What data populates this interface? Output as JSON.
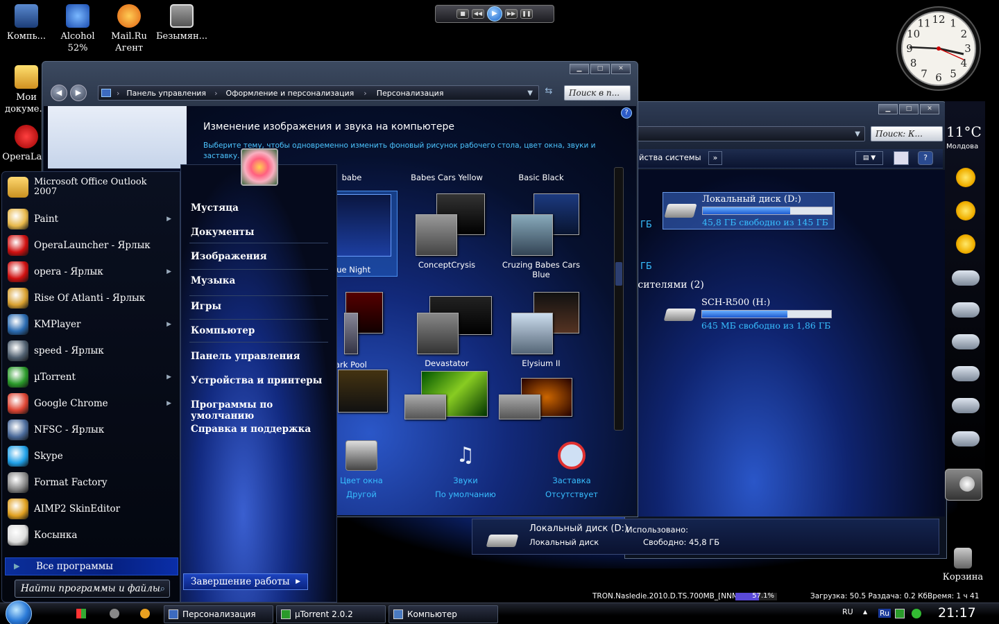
{
  "desktop": {
    "icons": [
      {
        "label": "Компь...",
        "icon": "computer-icon"
      },
      {
        "label": "Alcohol 52%",
        "icon": "alcohol-icon"
      },
      {
        "label": "Mail.Ru Агент",
        "icon": "mailru-agent-icon"
      },
      {
        "label": "Безымян...",
        "icon": "image-file-icon"
      },
      {
        "label": "Мои докуме...",
        "icon": "my-documents-icon"
      },
      {
        "label": "OperaLa...",
        "icon": "opera-icon"
      },
      {
        "label": "Корзина",
        "icon": "recycle-bin-icon"
      }
    ]
  },
  "clock_gadget": {
    "numerals": [
      "12",
      "1",
      "2",
      "3",
      "4",
      "5",
      "6",
      "7",
      "8",
      "9",
      "10",
      "11"
    ]
  },
  "weather_gadget": {
    "temperature": "11°C",
    "city": "Молдова"
  },
  "control_panel": {
    "breadcrumb": [
      "Панель управления",
      "Оформление и персонализация",
      "Персонализация"
    ],
    "search_placeholder": "Поиск в п...",
    "title": "Изменение изображения и звука на компьютере",
    "description": "Выберите тему, чтобы одновременно изменить фоновый рисунок рабочего стола, цвет окна, звуки и заставку.",
    "themes": [
      {
        "label": "babe"
      },
      {
        "label": "Babes Cars Yellow"
      },
      {
        "label": "Basic Black"
      },
      {
        "label": "lue Night"
      },
      {
        "label": "ConceptCrysis"
      },
      {
        "label": "Cruzing Babes Cars Blue"
      },
      {
        "label": "ark Pool"
      },
      {
        "label": "Devastator"
      },
      {
        "label": "Elysium II"
      }
    ],
    "bottom": [
      {
        "title": "Цвет окна",
        "value": "Другой"
      },
      {
        "title": "Звуки",
        "value": "По умолчанию"
      },
      {
        "title": "Заставка",
        "value": "Отсутствует"
      }
    ]
  },
  "computer_window": {
    "search_placeholder": "Поиск: К...",
    "toolbar_item": "йства системы",
    "partial_gb_1": "ГБ",
    "partial_gb_2": "ГБ",
    "drives": [
      {
        "name": "Локальный диск (D:)",
        "free": "45,8 ГБ свободно из 145 ГБ",
        "fill": 0.68
      },
      {
        "name": "SCH-R500 (H:)",
        "free": "645 МБ свободно из 1,86 ГБ",
        "fill": 0.66
      }
    ],
    "removable_header": "осителями (2)",
    "details": {
      "name": "Локальный диск (D:)",
      "type": "Локальный диск",
      "used_label": "Использовано:",
      "free_label": "Свободно: 45,8 ГБ"
    }
  },
  "start_menu": {
    "pinned_overlap": "Microsoft Office Outlook 2007",
    "programs": [
      {
        "label": "Paint",
        "arrow": true,
        "color": "#e8b84a"
      },
      {
        "label": "OperaLauncher - Ярлык",
        "arrow": false,
        "color": "#d01010"
      },
      {
        "label": "opera - Ярлык",
        "arrow": true,
        "color": "#d01010"
      },
      {
        "label": "Rise Of Atlanti - Ярлык",
        "arrow": false,
        "color": "#d8a030"
      },
      {
        "label": "KMPlayer",
        "arrow": true,
        "color": "#2a6ab0"
      },
      {
        "label": "speed - Ярлык",
        "arrow": false,
        "color": "#506070"
      },
      {
        "label": "µTorrent",
        "arrow": true,
        "color": "#2a9a2a"
      },
      {
        "label": "Google Chrome",
        "arrow": true,
        "color": "#dd4433"
      },
      {
        "label": "NFSC - Ярлык",
        "arrow": false,
        "color": "#4a6a9a"
      },
      {
        "label": "Skype",
        "arrow": false,
        "color": "#1fa0e8"
      },
      {
        "label": "Format Factory",
        "arrow": false,
        "color": "#888888"
      },
      {
        "label": "AIMP2 SkinEditor",
        "arrow": false,
        "color": "#e0a020"
      },
      {
        "label": "Косынка",
        "arrow": false,
        "color": "#dddddd"
      }
    ],
    "all_programs": "Все программы",
    "search_placeholder": "Найти программы и файлы",
    "right_items": [
      "Мустяца",
      "Документы",
      "Изображения",
      "Музыка",
      "Игры",
      "Компьютер",
      "Панель управления",
      "Устройства и принтеры",
      "Программы по умолчанию",
      "Справка и поддержка"
    ],
    "shutdown": "Завершение работы"
  },
  "status_line": {
    "torrent": "TRON.Nasledie.2010.D.TS.700MB_[NNM-",
    "percent": "57.1%",
    "progress": 0.571,
    "speeds": "Загрузка: 50.5 Раздача: 0.2 КбВремя: 1 ч 41"
  },
  "taskbar": {
    "buttons": [
      "Персонализация",
      "µTorrent 2.0.2",
      "Компьютер"
    ],
    "lang": "RU",
    "lang2": "Ru",
    "time": "21:17"
  }
}
